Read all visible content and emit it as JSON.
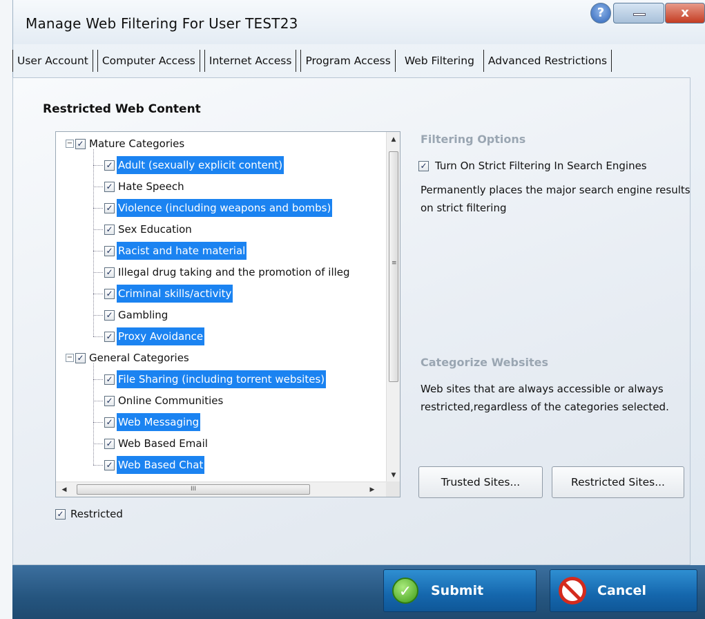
{
  "window": {
    "title": "Manage Web Filtering For User TEST23",
    "help_glyph": "?",
    "close_glyph": "x"
  },
  "tabs": [
    {
      "label": "User Account"
    },
    {
      "label": "Computer Access"
    },
    {
      "label": "Internet Access"
    },
    {
      "label": "Program Access"
    },
    {
      "label": "Web Filtering",
      "active": true
    },
    {
      "label": "Advanced Restrictions"
    }
  ],
  "restricted_content": {
    "title": "Restricted Web Content",
    "tree": [
      {
        "label": "Mature Categories",
        "level": 0,
        "checked": true,
        "selected": false,
        "expander": "−"
      },
      {
        "label": "Adult (sexually explicit content)",
        "level": 1,
        "checked": true,
        "selected": true
      },
      {
        "label": "Hate Speech",
        "level": 1,
        "checked": true,
        "selected": false
      },
      {
        "label": "Violence (including weapons and bombs)",
        "level": 1,
        "checked": true,
        "selected": true
      },
      {
        "label": "Sex Education",
        "level": 1,
        "checked": true,
        "selected": false
      },
      {
        "label": "Racist and hate material",
        "level": 1,
        "checked": true,
        "selected": true
      },
      {
        "label": "Illegal drug taking and the promotion of illeg",
        "level": 1,
        "checked": true,
        "selected": false
      },
      {
        "label": "Criminal skills/activity",
        "level": 1,
        "checked": true,
        "selected": true
      },
      {
        "label": "Gambling",
        "level": 1,
        "checked": true,
        "selected": false
      },
      {
        "label": "Proxy Avoidance",
        "level": 1,
        "checked": true,
        "selected": true
      },
      {
        "label": "General Categories",
        "level": 0,
        "checked": true,
        "selected": false,
        "expander": "−"
      },
      {
        "label": "File Sharing (including torrent websites)",
        "level": 1,
        "checked": true,
        "selected": true
      },
      {
        "label": "Online Communities",
        "level": 1,
        "checked": true,
        "selected": false
      },
      {
        "label": "Web Messaging",
        "level": 1,
        "checked": true,
        "selected": true
      },
      {
        "label": "Web Based Email",
        "level": 1,
        "checked": true,
        "selected": false
      },
      {
        "label": "Web Based Chat",
        "level": 1,
        "checked": true,
        "selected": true
      }
    ],
    "scroll_grip": "III",
    "restricted_checkbox": {
      "label": "Restricted",
      "checked": true
    }
  },
  "filtering_options": {
    "title": "Filtering Options",
    "strict_label": "Turn On Strict Filtering In Search Engines",
    "strict_checked": true,
    "description": "Permanently places the major search engine results on strict filtering"
  },
  "categorize": {
    "title": "Categorize Websites",
    "description": "Web sites that are always accessible or always restricted,regardless of the categories selected.",
    "trusted_button": "Trusted Sites...",
    "restricted_button": "Restricted Sites..."
  },
  "footer": {
    "submit_label": "Submit",
    "cancel_label": "Cancel"
  },
  "check_glyph": "✓"
}
